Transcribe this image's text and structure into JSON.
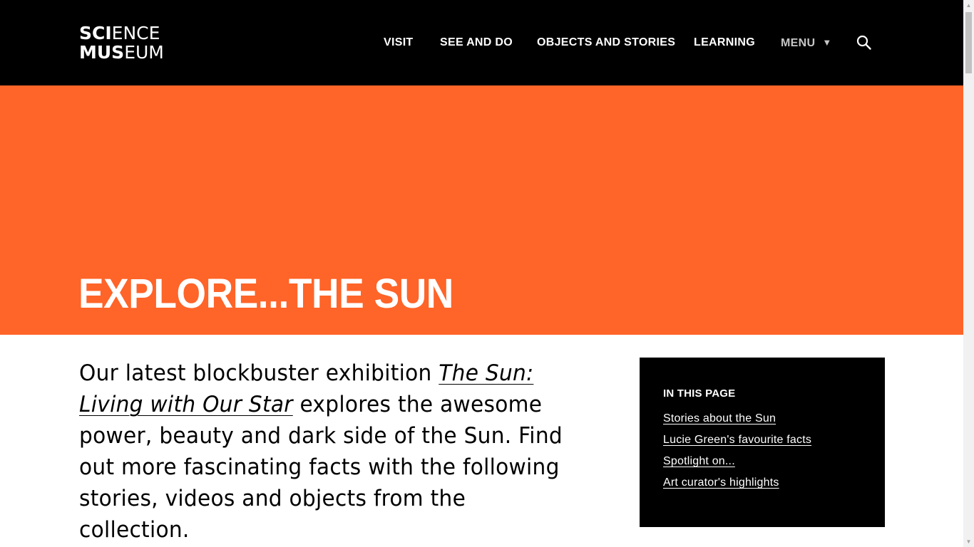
{
  "header": {
    "logo": {
      "line1_bold": "SCI",
      "line1_light": "ENCE",
      "line2_bold": "MUS",
      "line2_light": "EUM"
    },
    "nav": [
      {
        "label": "VISIT"
      },
      {
        "label": "SEE AND DO"
      },
      {
        "label": "OBJECTS AND STORIES"
      },
      {
        "label": "LEARNING"
      },
      {
        "label": "MENU"
      }
    ],
    "menu_caret": "▼",
    "search_icon": "search-icon"
  },
  "hero": {
    "title": "EXPLORE...THE SUN",
    "background_color": "#ff6428"
  },
  "intro": {
    "text_before": "Our latest blockbuster exhibition ",
    "link_text": "The Sun: Living with Our Star",
    "text_after": " explores the awesome power, beauty and dark side of the Sun. Find out more fascinating facts with the following stories, videos and objects from the collection."
  },
  "toc": {
    "heading": "IN THIS PAGE",
    "links": [
      {
        "label": "Stories about the Sun"
      },
      {
        "label": "Lucie Green's favourite facts"
      },
      {
        "label": "Spotlight on..."
      },
      {
        "label": "Art curator's highlights"
      }
    ]
  },
  "scrollbar": {
    "up_arrow": "▲",
    "down_arrow": "▼"
  }
}
